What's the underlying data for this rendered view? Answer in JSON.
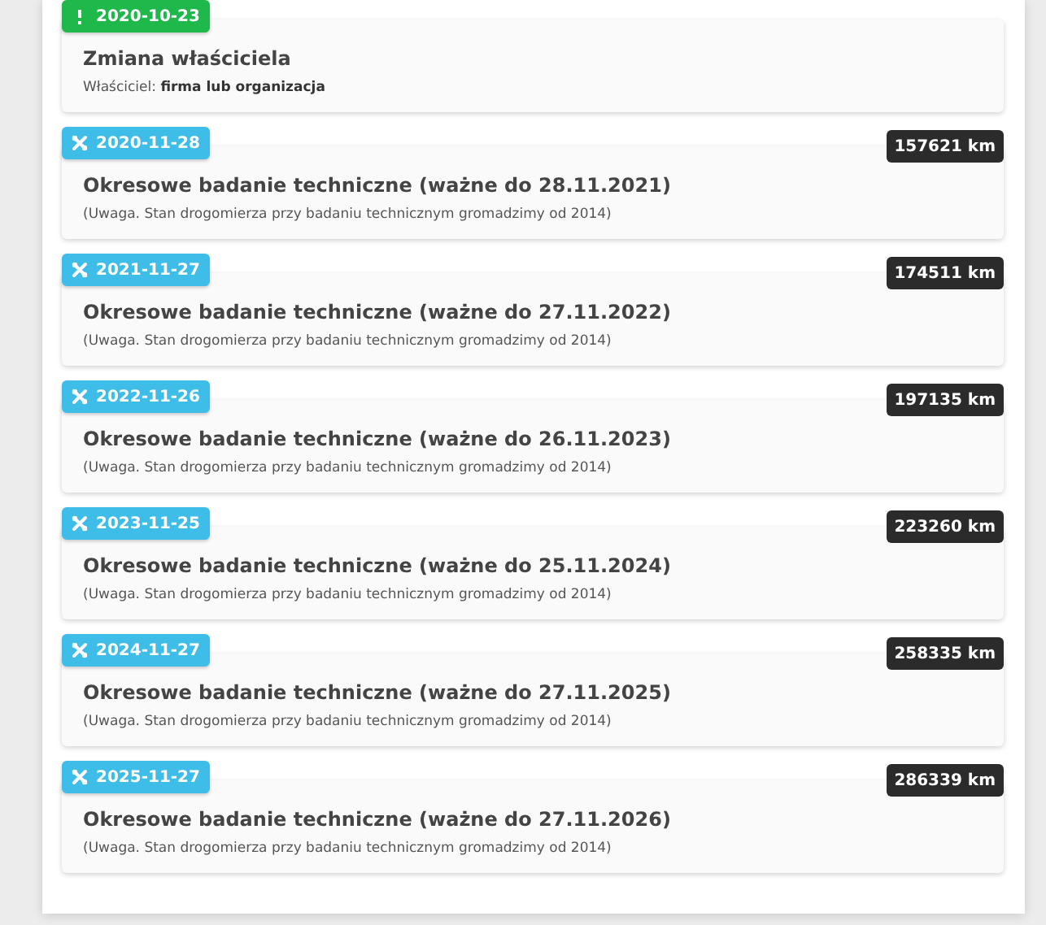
{
  "events": [
    {
      "kind": "ownership",
      "date": "2020-10-23",
      "title": "Zmiana właściciela",
      "note": "Właściciel: **firma lub organizacja**"
    },
    {
      "kind": "inspection",
      "date": "2020-11-28",
      "mileage": "157621 km",
      "title": "Okresowe badanie techniczne (ważne do 28.11.2021)",
      "note": "(Uwaga. Stan drogomierza przy badaniu technicznym gromadzimy od 2014)"
    },
    {
      "kind": "inspection",
      "date": "2021-11-27",
      "mileage": "174511 km",
      "title": "Okresowe badanie techniczne (ważne do 27.11.2022)",
      "note": "(Uwaga. Stan drogomierza przy badaniu technicznym gromadzimy od 2014)"
    },
    {
      "kind": "inspection",
      "date": "2022-11-26",
      "mileage": "197135 km",
      "title": "Okresowe badanie techniczne (ważne do 26.11.2023)",
      "note": "(Uwaga. Stan drogomierza przy badaniu technicznym gromadzimy od 2014)"
    },
    {
      "kind": "inspection",
      "date": "2023-11-25",
      "mileage": "223260 km",
      "title": "Okresowe badanie techniczne (ważne do 25.11.2024)",
      "note": "(Uwaga. Stan drogomierza przy badaniu technicznym gromadzimy od 2014)"
    },
    {
      "kind": "inspection",
      "date": "2024-11-27",
      "mileage": "258335 km",
      "title": "Okresowe badanie techniczne (ważne do 27.11.2025)",
      "note": "(Uwaga. Stan drogomierza przy badaniu technicznym gromadzimy od 2014)"
    },
    {
      "kind": "inspection",
      "date": "2025-11-27",
      "mileage": "286339 km",
      "title": "Okresowe badanie techniczne (ważne do 27.11.2026)",
      "note": "(Uwaga. Stan drogomierza przy badaniu technicznym gromadzimy od 2014)"
    }
  ]
}
